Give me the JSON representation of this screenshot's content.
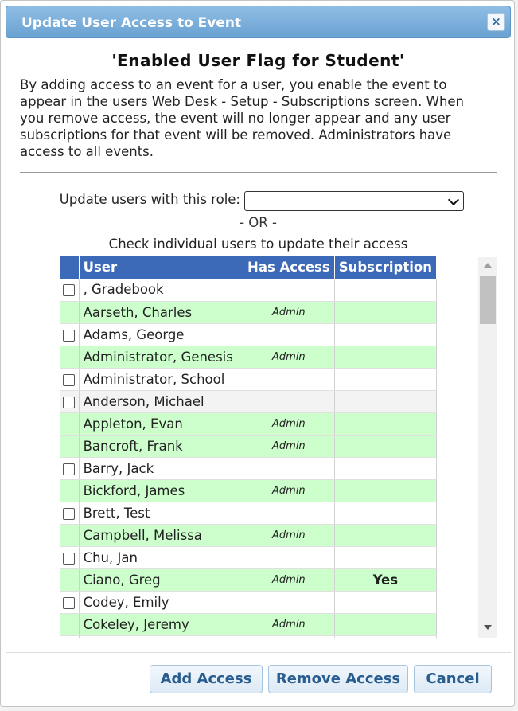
{
  "dialog": {
    "title": "Update User Access to Event",
    "close_icon": "×",
    "heading": "'Enabled User Flag for Student'",
    "intro": "By adding access to an event for a user, you enable the event to appear in the users Web Desk - Setup - Subscriptions screen. When you remove access, the event will no longer appear and any user subscriptions for that event will be removed. Administrators have access to all events."
  },
  "role": {
    "label": "Update users with this role:",
    "selected": ""
  },
  "or_text": "- OR -",
  "check_text": "Check individual users to update their access",
  "table": {
    "headers": [
      "",
      "User",
      "Has Access",
      "Subscription"
    ],
    "rows": [
      {
        "user": ", Gradebook",
        "access": "",
        "subscription": "",
        "checkbox": true
      },
      {
        "user": "Aarseth, Charles",
        "access": "Admin",
        "subscription": "",
        "checkbox": false
      },
      {
        "user": "Adams, George",
        "access": "",
        "subscription": "",
        "checkbox": true
      },
      {
        "user": "Administrator, Genesis",
        "access": "Admin",
        "subscription": "",
        "checkbox": false
      },
      {
        "user": "Administrator, School",
        "access": "",
        "subscription": "",
        "checkbox": true
      },
      {
        "user": "Anderson, Michael",
        "access": "",
        "subscription": "",
        "checkbox": true
      },
      {
        "user": "Appleton, Evan",
        "access": "Admin",
        "subscription": "",
        "checkbox": false
      },
      {
        "user": "Bancroft, Frank",
        "access": "Admin",
        "subscription": "",
        "checkbox": false
      },
      {
        "user": "Barry, Jack",
        "access": "",
        "subscription": "",
        "checkbox": true
      },
      {
        "user": "Bickford, James",
        "access": "Admin",
        "subscription": "",
        "checkbox": false
      },
      {
        "user": "Brett, Test",
        "access": "",
        "subscription": "",
        "checkbox": true
      },
      {
        "user": "Campbell, Melissa",
        "access": "Admin",
        "subscription": "",
        "checkbox": false
      },
      {
        "user": "Chu, Jan",
        "access": "",
        "subscription": "",
        "checkbox": true
      },
      {
        "user": "Ciano, Greg",
        "access": "Admin",
        "subscription": "Yes",
        "checkbox": false
      },
      {
        "user": "Codey, Emily",
        "access": "",
        "subscription": "",
        "checkbox": true
      },
      {
        "user": "Cokeley, Jeremy",
        "access": "Admin",
        "subscription": "",
        "checkbox": false
      },
      {
        "user": "",
        "access": "",
        "subscription": "",
        "checkbox": true
      }
    ]
  },
  "buttons": {
    "add": "Add Access",
    "remove": "Remove Access",
    "cancel": "Cancel"
  },
  "colors": {
    "titlebar": "#6aa2d2",
    "table_header": "#3d6ab8",
    "admin_row": "#ccffcc",
    "button_text": "#2a5d8f"
  }
}
